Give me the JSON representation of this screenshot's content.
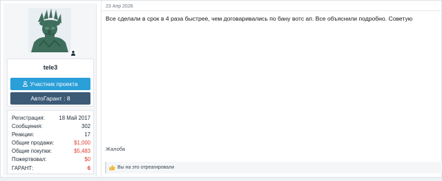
{
  "post": {
    "date": "23 Апр 2026",
    "message": "Все сделали в срок в 4 раза быстрее, чем договаривались по бану вотс ап. Все объяснили подробно. Советую",
    "report_label": "Жалоба",
    "reactions_text": "Вы на это отреагировали"
  },
  "user": {
    "username": "tele3",
    "member_button": "Участник проекта",
    "guarantee_button": "АвтоГарант : 8",
    "stats": [
      {
        "label": "Регистрация:",
        "value": "18 Май 2017"
      },
      {
        "label": "Сообщения:",
        "value": "302"
      },
      {
        "label": "Реакции:",
        "value": "17"
      },
      {
        "label": "Общие продажи:",
        "value": "$1,000"
      },
      {
        "label": "Общие покупки:",
        "value": "$5,483"
      },
      {
        "label": "Пожертвовал:",
        "value": "$0"
      },
      {
        "label": "ГАРАНТ:",
        "value": "6"
      }
    ]
  },
  "colors": {
    "member_button": "#2b9fd8",
    "guarantee_button": "#3c5976",
    "money_red": "#e03b2f"
  },
  "icons": [
    "user-icon",
    "online-status-icon",
    "thumbs-up-icon"
  ]
}
